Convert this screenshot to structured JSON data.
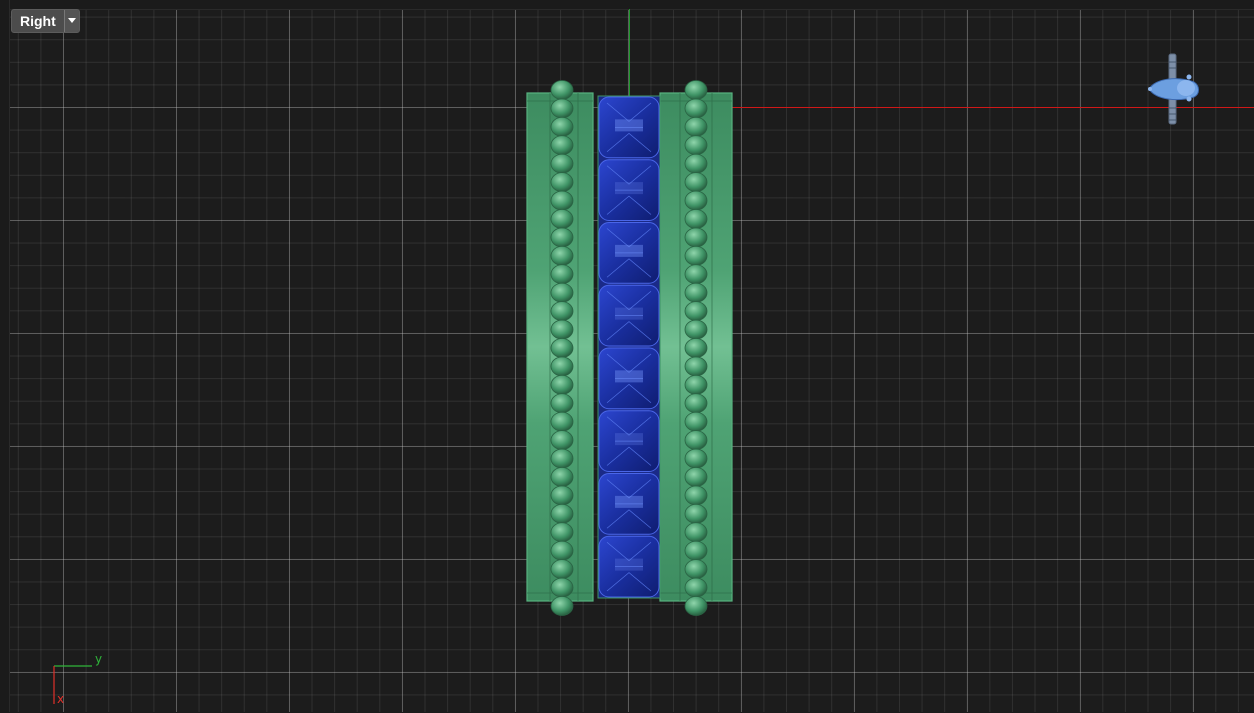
{
  "viewport": {
    "view_name": "Right",
    "grid_color": "#c8c8c8",
    "background": "#1c1c1c"
  },
  "axes": {
    "x_color": "#d01818",
    "y_color": "#1f9a2c",
    "triad": {
      "x_label": "x",
      "y_label": "y"
    }
  },
  "model": {
    "band_color": "#3f9466",
    "stone_color": "#1d33a6",
    "stone_count": 8,
    "bead_count_per_row": 29
  },
  "icons": {
    "view_dropdown": "chevron-down-icon",
    "camera": "camera-gizmo-icon"
  }
}
